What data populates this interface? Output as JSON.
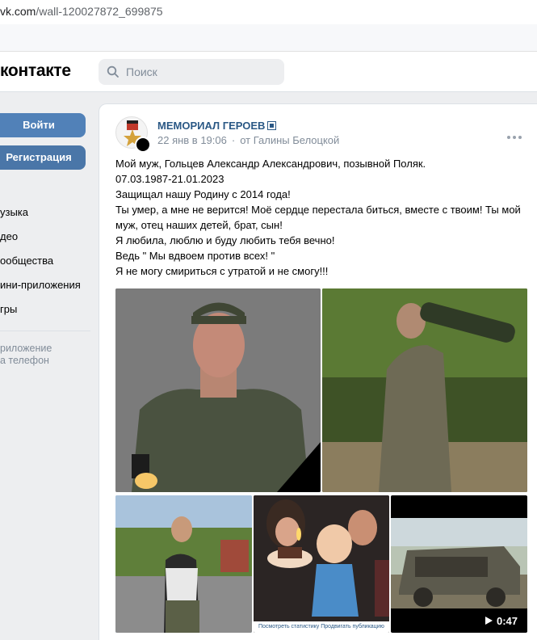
{
  "browser": {
    "url_host": "vk.com",
    "url_path": "/wall-120027872_699875"
  },
  "header": {
    "logo": "контакте",
    "search_placeholder": "Поиск"
  },
  "sidebar": {
    "login_label": "Войти",
    "register_label": "Регистрация",
    "items": [
      {
        "label": "узыка"
      },
      {
        "label": "део"
      },
      {
        "label": "ообщества"
      },
      {
        "label": "ини-приложения"
      },
      {
        "label": "гры"
      }
    ],
    "app_line1": "риложение",
    "app_line2": "а телефон"
  },
  "post": {
    "author": "МЕМОРИАЛ ГЕРОЕВ",
    "date": "22 янв в 19:06",
    "separator": "·",
    "from": "от Галины Белоцкой",
    "text_lines": [
      "Мой муж, Гольцев Александр Александрович, позывной Поляк.",
      "07.03.1987-21.01.2023",
      "Защищал нашу Родину с 2014 года!",
      "Ты умер, а мне не верится! Моё сердце перестала биться, вместе с твоим! Ты мой",
      "муж, отец наших детей, брат, сын!",
      "Я любила, люблю и буду любить тебя вечно!",
      "Ведь \" Мы вдвоем против всех! \"",
      "Я не могу смириться с утратой и не смогу!!!"
    ],
    "photo4_caption": "Посмотреть статистику  Продвигать публикацию",
    "video_duration": "0:47"
  },
  "colors": {
    "vk_blue": "#5181b8",
    "link": "#2a5885",
    "muted": "#818c99",
    "page_bg": "#edeef0"
  }
}
